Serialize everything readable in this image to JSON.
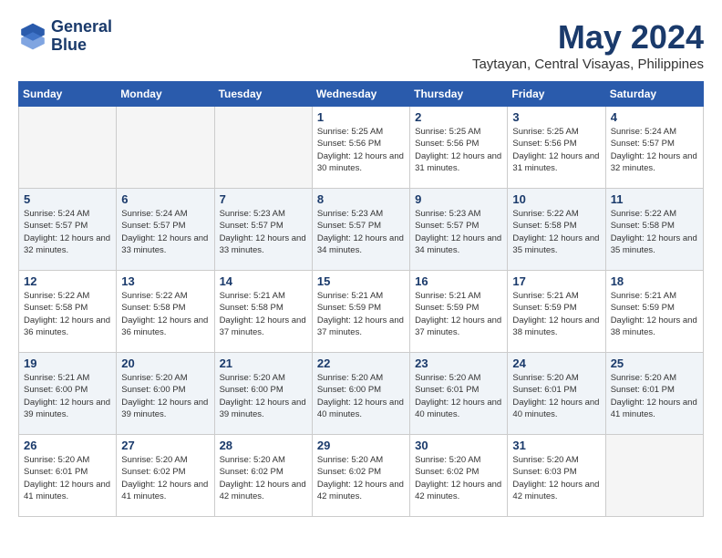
{
  "header": {
    "logo_line1": "General",
    "logo_line2": "Blue",
    "month_title": "May 2024",
    "location": "Taytayan, Central Visayas, Philippines"
  },
  "weekdays": [
    "Sunday",
    "Monday",
    "Tuesday",
    "Wednesday",
    "Thursday",
    "Friday",
    "Saturday"
  ],
  "weeks": [
    [
      {
        "day": "",
        "empty": true
      },
      {
        "day": "",
        "empty": true
      },
      {
        "day": "",
        "empty": true
      },
      {
        "day": "1",
        "sunrise": "5:25 AM",
        "sunset": "5:56 PM",
        "daylight": "12 hours and 30 minutes."
      },
      {
        "day": "2",
        "sunrise": "5:25 AM",
        "sunset": "5:56 PM",
        "daylight": "12 hours and 31 minutes."
      },
      {
        "day": "3",
        "sunrise": "5:25 AM",
        "sunset": "5:56 PM",
        "daylight": "12 hours and 31 minutes."
      },
      {
        "day": "4",
        "sunrise": "5:24 AM",
        "sunset": "5:57 PM",
        "daylight": "12 hours and 32 minutes."
      }
    ],
    [
      {
        "day": "5",
        "sunrise": "5:24 AM",
        "sunset": "5:57 PM",
        "daylight": "12 hours and 32 minutes."
      },
      {
        "day": "6",
        "sunrise": "5:24 AM",
        "sunset": "5:57 PM",
        "daylight": "12 hours and 33 minutes."
      },
      {
        "day": "7",
        "sunrise": "5:23 AM",
        "sunset": "5:57 PM",
        "daylight": "12 hours and 33 minutes."
      },
      {
        "day": "8",
        "sunrise": "5:23 AM",
        "sunset": "5:57 PM",
        "daylight": "12 hours and 34 minutes."
      },
      {
        "day": "9",
        "sunrise": "5:23 AM",
        "sunset": "5:57 PM",
        "daylight": "12 hours and 34 minutes."
      },
      {
        "day": "10",
        "sunrise": "5:22 AM",
        "sunset": "5:58 PM",
        "daylight": "12 hours and 35 minutes."
      },
      {
        "day": "11",
        "sunrise": "5:22 AM",
        "sunset": "5:58 PM",
        "daylight": "12 hours and 35 minutes."
      }
    ],
    [
      {
        "day": "12",
        "sunrise": "5:22 AM",
        "sunset": "5:58 PM",
        "daylight": "12 hours and 36 minutes."
      },
      {
        "day": "13",
        "sunrise": "5:22 AM",
        "sunset": "5:58 PM",
        "daylight": "12 hours and 36 minutes."
      },
      {
        "day": "14",
        "sunrise": "5:21 AM",
        "sunset": "5:58 PM",
        "daylight": "12 hours and 37 minutes."
      },
      {
        "day": "15",
        "sunrise": "5:21 AM",
        "sunset": "5:59 PM",
        "daylight": "12 hours and 37 minutes."
      },
      {
        "day": "16",
        "sunrise": "5:21 AM",
        "sunset": "5:59 PM",
        "daylight": "12 hours and 37 minutes."
      },
      {
        "day": "17",
        "sunrise": "5:21 AM",
        "sunset": "5:59 PM",
        "daylight": "12 hours and 38 minutes."
      },
      {
        "day": "18",
        "sunrise": "5:21 AM",
        "sunset": "5:59 PM",
        "daylight": "12 hours and 38 minutes."
      }
    ],
    [
      {
        "day": "19",
        "sunrise": "5:21 AM",
        "sunset": "6:00 PM",
        "daylight": "12 hours and 39 minutes."
      },
      {
        "day": "20",
        "sunrise": "5:20 AM",
        "sunset": "6:00 PM",
        "daylight": "12 hours and 39 minutes."
      },
      {
        "day": "21",
        "sunrise": "5:20 AM",
        "sunset": "6:00 PM",
        "daylight": "12 hours and 39 minutes."
      },
      {
        "day": "22",
        "sunrise": "5:20 AM",
        "sunset": "6:00 PM",
        "daylight": "12 hours and 40 minutes."
      },
      {
        "day": "23",
        "sunrise": "5:20 AM",
        "sunset": "6:01 PM",
        "daylight": "12 hours and 40 minutes."
      },
      {
        "day": "24",
        "sunrise": "5:20 AM",
        "sunset": "6:01 PM",
        "daylight": "12 hours and 40 minutes."
      },
      {
        "day": "25",
        "sunrise": "5:20 AM",
        "sunset": "6:01 PM",
        "daylight": "12 hours and 41 minutes."
      }
    ],
    [
      {
        "day": "26",
        "sunrise": "5:20 AM",
        "sunset": "6:01 PM",
        "daylight": "12 hours and 41 minutes."
      },
      {
        "day": "27",
        "sunrise": "5:20 AM",
        "sunset": "6:02 PM",
        "daylight": "12 hours and 41 minutes."
      },
      {
        "day": "28",
        "sunrise": "5:20 AM",
        "sunset": "6:02 PM",
        "daylight": "12 hours and 42 minutes."
      },
      {
        "day": "29",
        "sunrise": "5:20 AM",
        "sunset": "6:02 PM",
        "daylight": "12 hours and 42 minutes."
      },
      {
        "day": "30",
        "sunrise": "5:20 AM",
        "sunset": "6:02 PM",
        "daylight": "12 hours and 42 minutes."
      },
      {
        "day": "31",
        "sunrise": "5:20 AM",
        "sunset": "6:03 PM",
        "daylight": "12 hours and 42 minutes."
      },
      {
        "day": "",
        "empty": true
      }
    ]
  ]
}
